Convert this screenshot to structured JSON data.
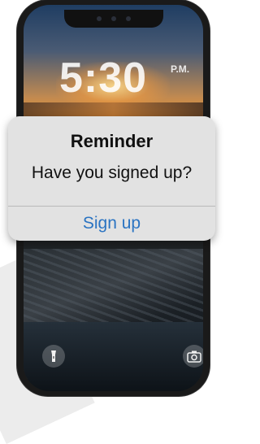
{
  "lock_screen": {
    "time": "5:30",
    "period": "P.M."
  },
  "alert": {
    "title": "Reminder",
    "message": "Have you signed up?",
    "action_label": "Sign up"
  },
  "colors": {
    "alert_bg": "#e2e2e2",
    "action_text": "#2b74c2"
  },
  "icons": [
    "flashlight-icon",
    "camera-icon"
  ]
}
